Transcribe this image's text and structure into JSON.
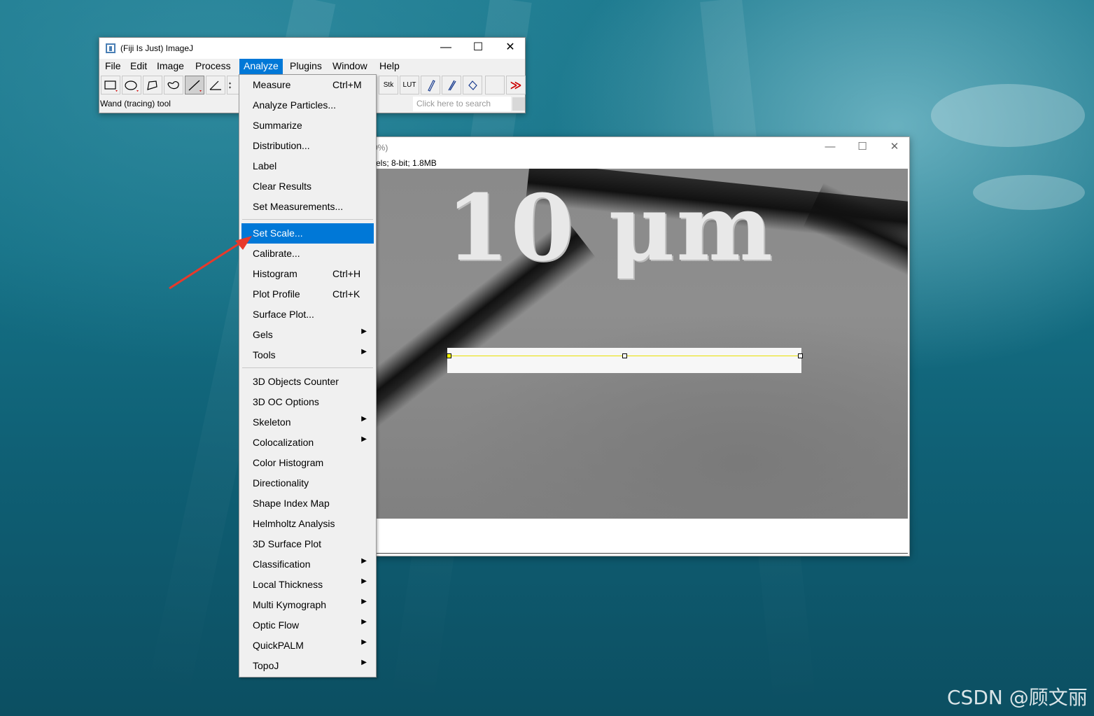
{
  "main_window": {
    "title": "(Fiji Is Just) ImageJ",
    "minimize": "—",
    "maximize": "☐",
    "close": "✕",
    "menus": [
      "File",
      "Edit",
      "Image",
      "Process",
      "Analyze",
      "Plugins",
      "Window",
      "Help"
    ],
    "active_menu": "Analyze",
    "tools": {
      "stk_label": "Stk",
      "lut_label": "LUT",
      "more_label": "≫"
    },
    "status": "Wand (tracing) tool",
    "search_placeholder": "Click here to search"
  },
  "image_window": {
    "title_partial": "0%)",
    "info_partial": "els; 8-bit; 1.8MB",
    "minimize": "—",
    "maximize": "☐",
    "close": "✕",
    "scale_label": "10 μm"
  },
  "analyze_menu": {
    "items": [
      {
        "label": "Measure",
        "shortcut": "Ctrl+M",
        "submenu": false
      },
      {
        "label": "Analyze Particles...",
        "shortcut": "",
        "submenu": false
      },
      {
        "label": "Summarize",
        "shortcut": "",
        "submenu": false
      },
      {
        "label": "Distribution...",
        "shortcut": "",
        "submenu": false
      },
      {
        "label": "Label",
        "shortcut": "",
        "submenu": false
      },
      {
        "label": "Clear Results",
        "shortcut": "",
        "submenu": false
      },
      {
        "label": "Set Measurements...",
        "shortcut": "",
        "submenu": false
      },
      {
        "label": "Set Scale...",
        "shortcut": "",
        "submenu": false,
        "highlighted": true
      },
      {
        "label": "Calibrate...",
        "shortcut": "",
        "submenu": false
      },
      {
        "label": "Histogram",
        "shortcut": "Ctrl+H",
        "submenu": false
      },
      {
        "label": "Plot Profile",
        "shortcut": "Ctrl+K",
        "submenu": false
      },
      {
        "label": "Surface Plot...",
        "shortcut": "",
        "submenu": false
      },
      {
        "label": "Gels",
        "shortcut": "",
        "submenu": true
      },
      {
        "label": "Tools",
        "shortcut": "",
        "submenu": true
      },
      {
        "label": "3D Objects Counter",
        "shortcut": "",
        "submenu": false
      },
      {
        "label": "3D OC Options",
        "shortcut": "",
        "submenu": false
      },
      {
        "label": "Skeleton",
        "shortcut": "",
        "submenu": true
      },
      {
        "label": "Colocalization",
        "shortcut": "",
        "submenu": true
      },
      {
        "label": "Color Histogram",
        "shortcut": "",
        "submenu": false
      },
      {
        "label": "Directionality",
        "shortcut": "",
        "submenu": false
      },
      {
        "label": "Shape Index Map",
        "shortcut": "",
        "submenu": false
      },
      {
        "label": "Helmholtz Analysis",
        "shortcut": "",
        "submenu": false
      },
      {
        "label": "3D Surface Plot",
        "shortcut": "",
        "submenu": false
      },
      {
        "label": "Classification",
        "shortcut": "",
        "submenu": true
      },
      {
        "label": "Local Thickness",
        "shortcut": "",
        "submenu": true
      },
      {
        "label": "Multi Kymograph",
        "shortcut": "",
        "submenu": true
      },
      {
        "label": "Optic Flow",
        "shortcut": "",
        "submenu": true
      },
      {
        "label": "QuickPALM",
        "shortcut": "",
        "submenu": true
      },
      {
        "label": "TopoJ",
        "shortcut": "",
        "submenu": true
      }
    ]
  },
  "colors": {
    "highlight": "#0078d7",
    "annotation_arrow": "#e8392b",
    "selection_line": "#e8e000"
  },
  "watermark": "CSDN @顾文丽"
}
